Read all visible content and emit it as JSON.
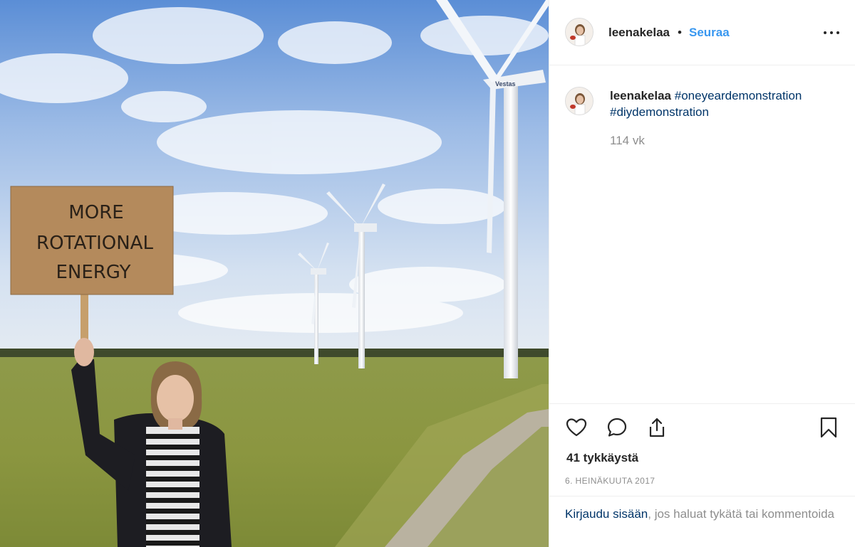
{
  "post": {
    "username": "leenakelaa",
    "separator": "•",
    "follow_label": "Seuraa",
    "more_icon": "more-options-icon",
    "photo": {
      "sign_lines": [
        "MORE",
        "ROTATIONAL",
        "ENERGY"
      ],
      "turbine_brand": "Vestas"
    }
  },
  "caption": {
    "username": "leenakelaa",
    "hashtag_1": "#oneyeardemonstration",
    "hashtag_2": "#diydemonstration",
    "time_ago": "114 vk"
  },
  "actions": {
    "icons": [
      "heart-icon",
      "comment-icon",
      "share-icon",
      "bookmark-icon"
    ],
    "likes_text": "41 tykkäystä",
    "date": "6. HEINÄKUUTA 2017"
  },
  "login": {
    "link_text": "Kirjaudu sisään",
    "rest_text": ", jos haluat tykätä tai kommentoida"
  },
  "colors": {
    "link_blue": "#3897f0",
    "hashtag_blue": "#003569",
    "secondary_text": "#8e8e8e",
    "divider": "#efefef"
  }
}
